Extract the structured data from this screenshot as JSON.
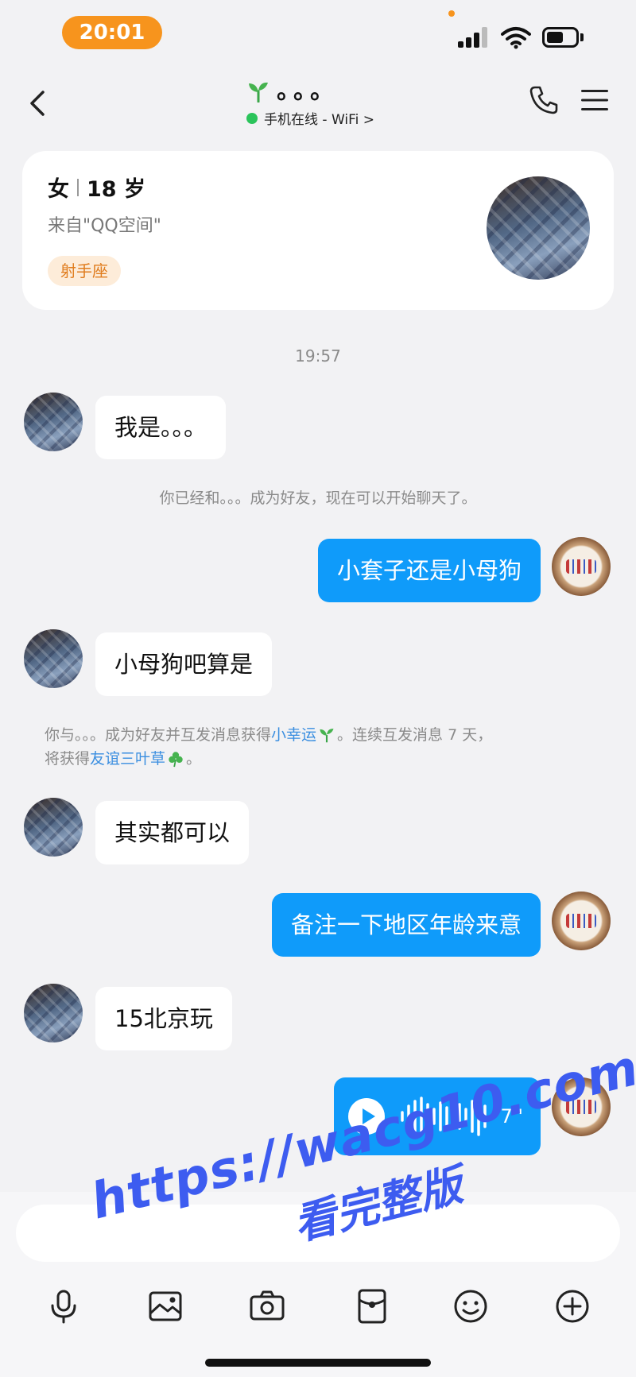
{
  "status_bar": {
    "time": "20:01"
  },
  "header": {
    "title": "。。。",
    "subtitle": "手机在线 - WiFi >"
  },
  "profile": {
    "gender": "女",
    "age": "18 岁",
    "source": "来自\"QQ空间\"",
    "zodiac": "射手座"
  },
  "chat": {
    "timestamp": "19:57",
    "messages": [
      {
        "from": "other",
        "text": "我是。。。"
      },
      {
        "type": "system",
        "text": "你已经和。。。成为好友，现在可以开始聊天了。"
      },
      {
        "from": "me",
        "text": "小套子还是小母狗"
      },
      {
        "from": "other",
        "text": "小母狗吧算是"
      },
      {
        "type": "system",
        "line1_prefix": "你与。。。成为好友并互发消息获得",
        "line1_link": "小幸运",
        "line1_suffix": "。连续互发消息 7 天，",
        "line2_prefix": "将获得",
        "line2_link": "友谊三叶草",
        "line2_suffix": "。"
      },
      {
        "from": "other",
        "text": "其实都可以"
      },
      {
        "from": "me",
        "text": "备注一下地区年龄来意"
      },
      {
        "from": "other",
        "text": "15北京玩"
      },
      {
        "from": "me",
        "type": "voice",
        "duration": "7''"
      }
    ]
  },
  "input": {
    "placeholder": ""
  },
  "watermark": {
    "line1": "https://wacg10.com",
    "line2": "看完整版"
  },
  "colors": {
    "accent": "#0f9bfa",
    "time_pill": "#f7941d",
    "online": "#2bc45b",
    "link": "#3a8ee0",
    "watermark": "#3d5cf0"
  }
}
